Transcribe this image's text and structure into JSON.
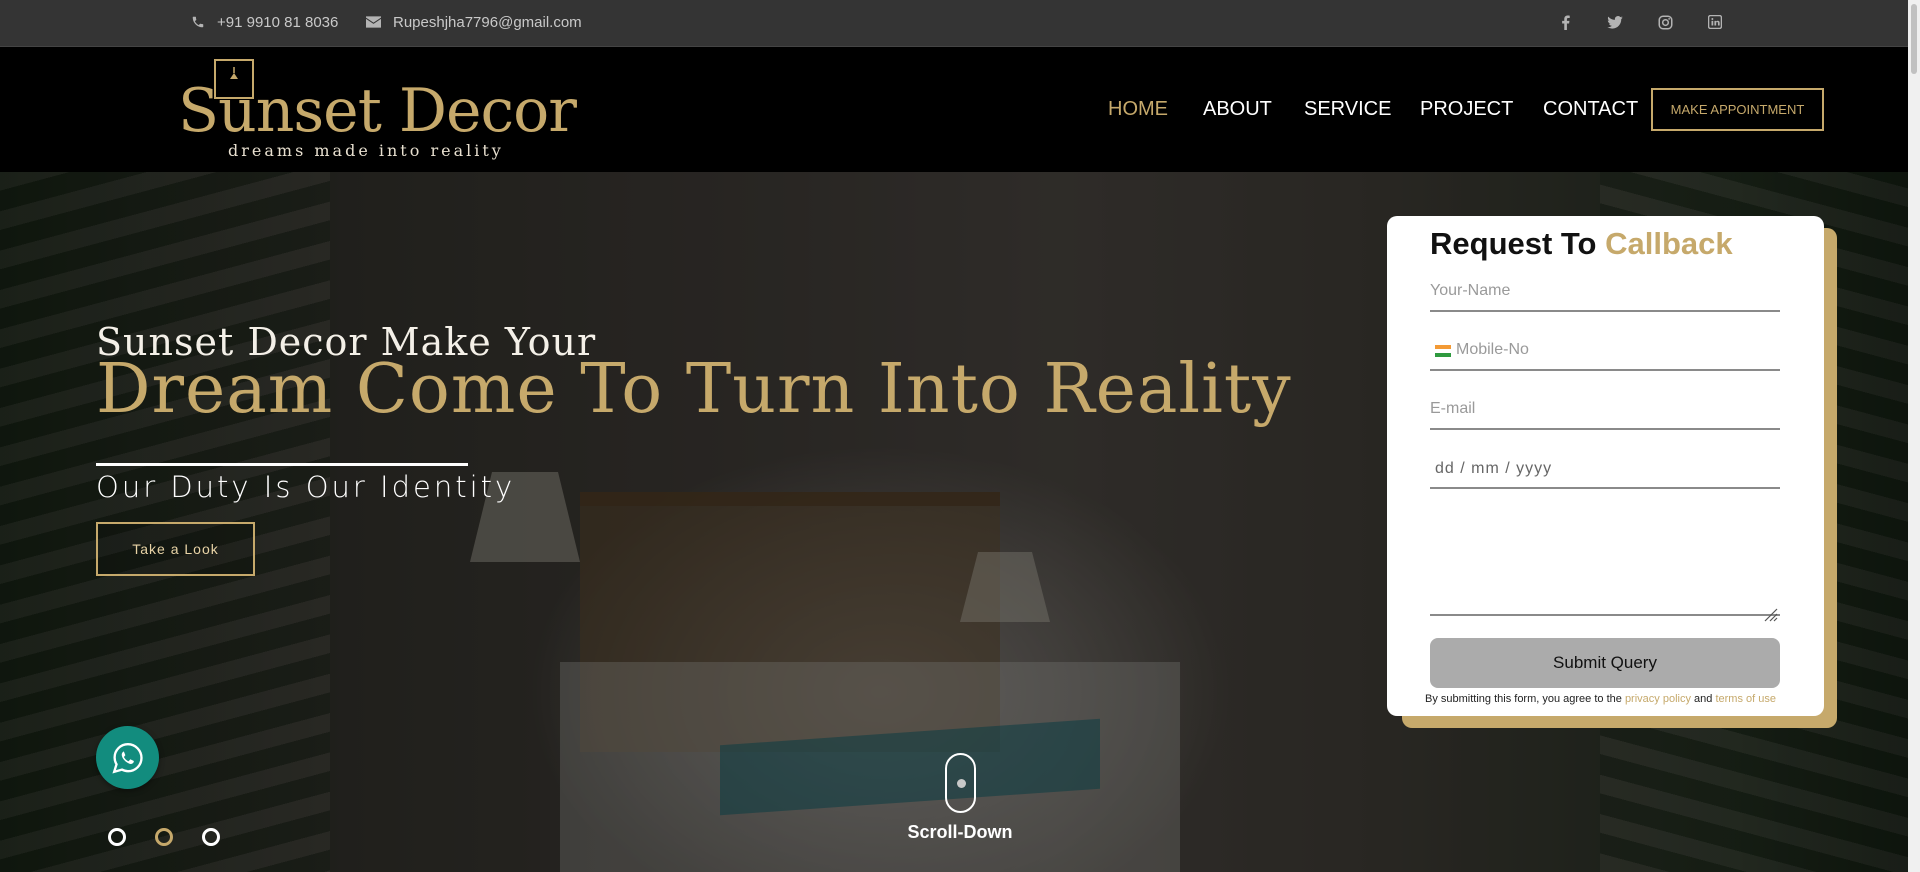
{
  "topbar": {
    "phone": "+91 9910 81 8036",
    "email": "Rupeshjha7796@gmail.com",
    "social_icons": [
      "facebook-icon",
      "twitter-icon",
      "instagram-icon",
      "linkedin-icon"
    ]
  },
  "header": {
    "logo_name": "Sunset Decor",
    "logo_tagline": "dreams made into reality",
    "nav": [
      "HOME",
      "ABOUT",
      "SERVICE",
      "PROJECT",
      "CONTACT"
    ],
    "active_nav": "HOME",
    "appointment_button": "MAKE APPOINTMENT"
  },
  "hero": {
    "subtitle": "Sunset Decor Make Your",
    "title": "Dream Come To Turn Into Reality",
    "tagline": "Our Duty Is Our Identity",
    "button": "Take a Look",
    "scroll_label": "Scroll-Down",
    "slides": 3,
    "active_slide": 2
  },
  "form": {
    "title_plain": "Request To",
    "title_accent": "Callback",
    "name_placeholder": "Your-Name",
    "mobile_placeholder": "Mobile-No",
    "email_placeholder": "E-mail",
    "date_placeholder": "dd / mm / yyyy",
    "submit_label": "Submit Query",
    "terms_prefix": "By submitting this form, you agree to the",
    "privacy_link": "privacy policy",
    "terms_and": "and",
    "terms_link": "terms of use"
  },
  "colors": {
    "accent_gold": "#c6a96b",
    "topbar_bg": "#343434",
    "header_bg": "#000000",
    "whatsapp_green": "#128c7e"
  }
}
